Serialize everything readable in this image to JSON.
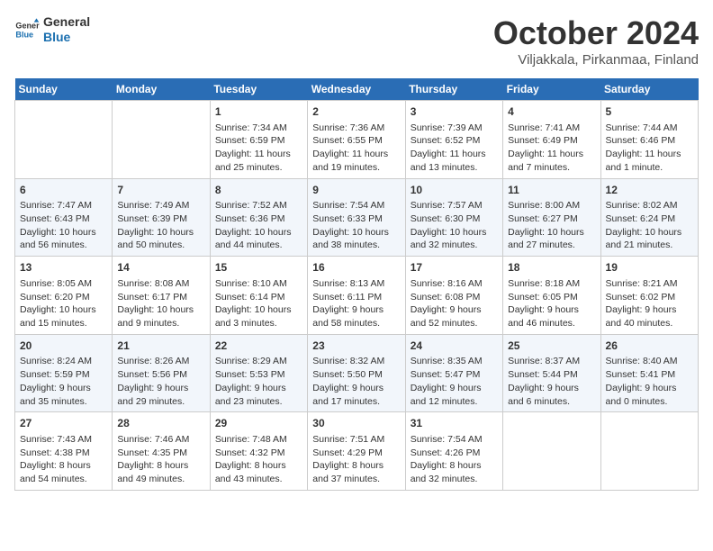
{
  "logo": {
    "line1": "General",
    "line2": "Blue"
  },
  "title": "October 2024",
  "subtitle": "Viljakkala, Pirkanmaa, Finland",
  "headers": [
    "Sunday",
    "Monday",
    "Tuesday",
    "Wednesday",
    "Thursday",
    "Friday",
    "Saturday"
  ],
  "weeks": [
    [
      {
        "day": "",
        "content": ""
      },
      {
        "day": "",
        "content": ""
      },
      {
        "day": "1",
        "content": "Sunrise: 7:34 AM\nSunset: 6:59 PM\nDaylight: 11 hours and 25 minutes."
      },
      {
        "day": "2",
        "content": "Sunrise: 7:36 AM\nSunset: 6:55 PM\nDaylight: 11 hours and 19 minutes."
      },
      {
        "day": "3",
        "content": "Sunrise: 7:39 AM\nSunset: 6:52 PM\nDaylight: 11 hours and 13 minutes."
      },
      {
        "day": "4",
        "content": "Sunrise: 7:41 AM\nSunset: 6:49 PM\nDaylight: 11 hours and 7 minutes."
      },
      {
        "day": "5",
        "content": "Sunrise: 7:44 AM\nSunset: 6:46 PM\nDaylight: 11 hours and 1 minute."
      }
    ],
    [
      {
        "day": "6",
        "content": "Sunrise: 7:47 AM\nSunset: 6:43 PM\nDaylight: 10 hours and 56 minutes."
      },
      {
        "day": "7",
        "content": "Sunrise: 7:49 AM\nSunset: 6:39 PM\nDaylight: 10 hours and 50 minutes."
      },
      {
        "day": "8",
        "content": "Sunrise: 7:52 AM\nSunset: 6:36 PM\nDaylight: 10 hours and 44 minutes."
      },
      {
        "day": "9",
        "content": "Sunrise: 7:54 AM\nSunset: 6:33 PM\nDaylight: 10 hours and 38 minutes."
      },
      {
        "day": "10",
        "content": "Sunrise: 7:57 AM\nSunset: 6:30 PM\nDaylight: 10 hours and 32 minutes."
      },
      {
        "day": "11",
        "content": "Sunrise: 8:00 AM\nSunset: 6:27 PM\nDaylight: 10 hours and 27 minutes."
      },
      {
        "day": "12",
        "content": "Sunrise: 8:02 AM\nSunset: 6:24 PM\nDaylight: 10 hours and 21 minutes."
      }
    ],
    [
      {
        "day": "13",
        "content": "Sunrise: 8:05 AM\nSunset: 6:20 PM\nDaylight: 10 hours and 15 minutes."
      },
      {
        "day": "14",
        "content": "Sunrise: 8:08 AM\nSunset: 6:17 PM\nDaylight: 10 hours and 9 minutes."
      },
      {
        "day": "15",
        "content": "Sunrise: 8:10 AM\nSunset: 6:14 PM\nDaylight: 10 hours and 3 minutes."
      },
      {
        "day": "16",
        "content": "Sunrise: 8:13 AM\nSunset: 6:11 PM\nDaylight: 9 hours and 58 minutes."
      },
      {
        "day": "17",
        "content": "Sunrise: 8:16 AM\nSunset: 6:08 PM\nDaylight: 9 hours and 52 minutes."
      },
      {
        "day": "18",
        "content": "Sunrise: 8:18 AM\nSunset: 6:05 PM\nDaylight: 9 hours and 46 minutes."
      },
      {
        "day": "19",
        "content": "Sunrise: 8:21 AM\nSunset: 6:02 PM\nDaylight: 9 hours and 40 minutes."
      }
    ],
    [
      {
        "day": "20",
        "content": "Sunrise: 8:24 AM\nSunset: 5:59 PM\nDaylight: 9 hours and 35 minutes."
      },
      {
        "day": "21",
        "content": "Sunrise: 8:26 AM\nSunset: 5:56 PM\nDaylight: 9 hours and 29 minutes."
      },
      {
        "day": "22",
        "content": "Sunrise: 8:29 AM\nSunset: 5:53 PM\nDaylight: 9 hours and 23 minutes."
      },
      {
        "day": "23",
        "content": "Sunrise: 8:32 AM\nSunset: 5:50 PM\nDaylight: 9 hours and 17 minutes."
      },
      {
        "day": "24",
        "content": "Sunrise: 8:35 AM\nSunset: 5:47 PM\nDaylight: 9 hours and 12 minutes."
      },
      {
        "day": "25",
        "content": "Sunrise: 8:37 AM\nSunset: 5:44 PM\nDaylight: 9 hours and 6 minutes."
      },
      {
        "day": "26",
        "content": "Sunrise: 8:40 AM\nSunset: 5:41 PM\nDaylight: 9 hours and 0 minutes."
      }
    ],
    [
      {
        "day": "27",
        "content": "Sunrise: 7:43 AM\nSunset: 4:38 PM\nDaylight: 8 hours and 54 minutes."
      },
      {
        "day": "28",
        "content": "Sunrise: 7:46 AM\nSunset: 4:35 PM\nDaylight: 8 hours and 49 minutes."
      },
      {
        "day": "29",
        "content": "Sunrise: 7:48 AM\nSunset: 4:32 PM\nDaylight: 8 hours and 43 minutes."
      },
      {
        "day": "30",
        "content": "Sunrise: 7:51 AM\nSunset: 4:29 PM\nDaylight: 8 hours and 37 minutes."
      },
      {
        "day": "31",
        "content": "Sunrise: 7:54 AM\nSunset: 4:26 PM\nDaylight: 8 hours and 32 minutes."
      },
      {
        "day": "",
        "content": ""
      },
      {
        "day": "",
        "content": ""
      }
    ]
  ]
}
